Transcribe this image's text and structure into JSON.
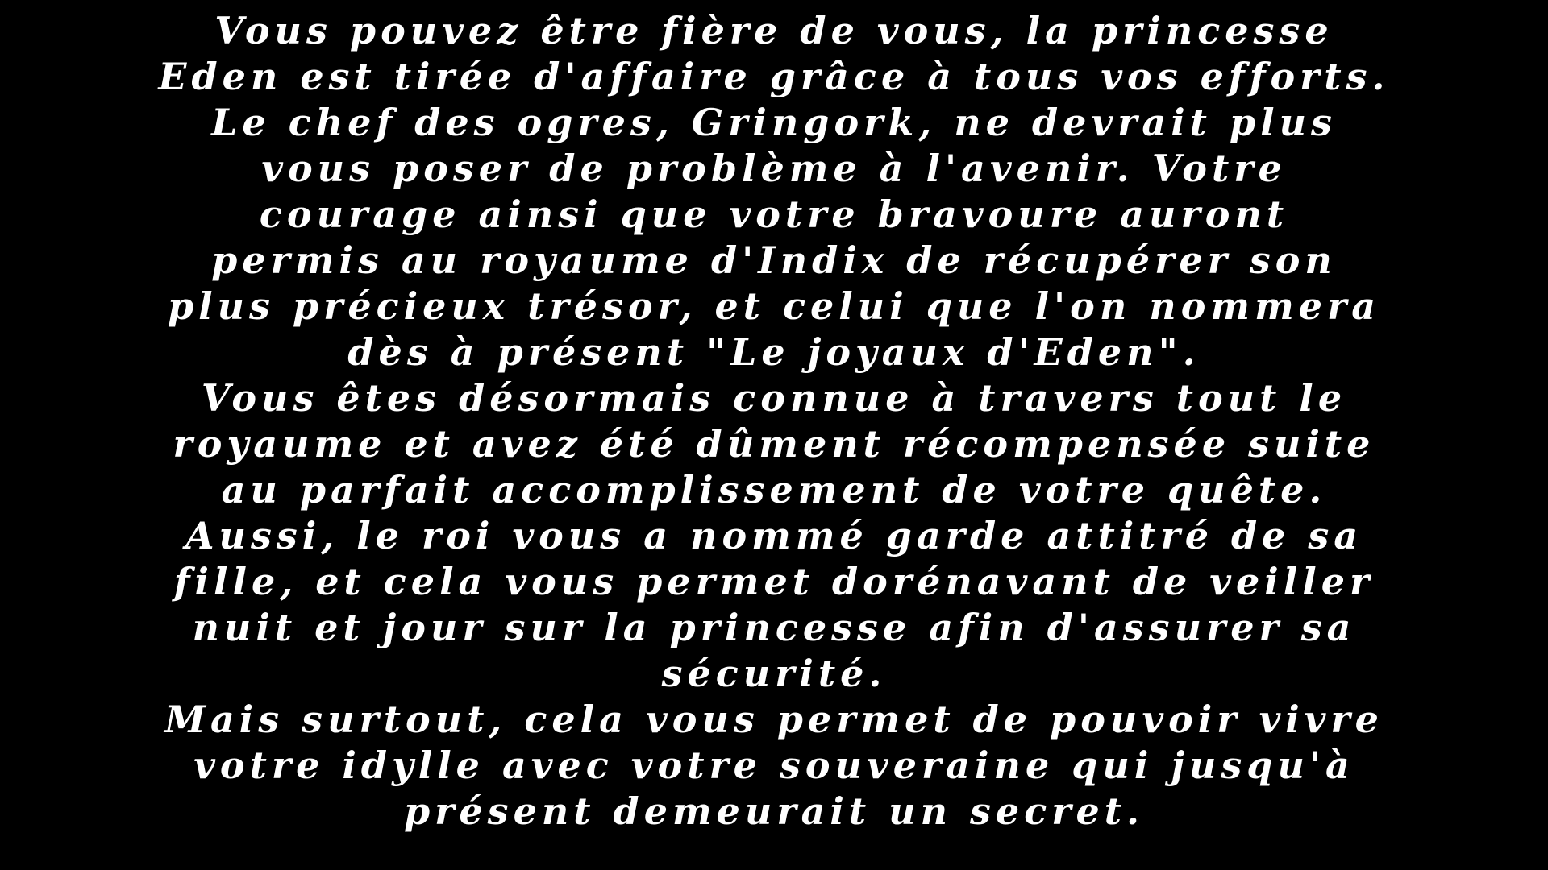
{
  "ending_text": {
    "lines": [
      "Vous pouvez être fière de vous, la princesse",
      "Eden est tirée d'affaire grâce à tous vos efforts.",
      "Le chef des ogres, Gringork, ne devrait plus",
      "vous poser de problème à l'avenir. Votre",
      "courage ainsi que votre bravoure auront",
      "permis au royaume d'Indix de récupérer son",
      "plus précieux trésor, et celui que l'on nommera",
      "dès à présent \"Le joyaux d'Eden\".",
      "Vous êtes désormais connue à travers tout le",
      "royaume et avez été dûment récompensée suite",
      "au parfait accomplissement de votre quête.",
      "Aussi, le roi vous a nommé garde attitré de sa",
      "fille, et cela vous permet dorénavant de veiller",
      "nuit et jour sur la princesse afin d'assurer sa",
      "sécurité.",
      "Mais surtout, cela vous permet de pouvoir vivre",
      "votre idylle avec votre souveraine qui jusqu'à",
      "présent demeurait un secret."
    ]
  },
  "colors": {
    "background": "#000000",
    "text": "#ffffff"
  }
}
